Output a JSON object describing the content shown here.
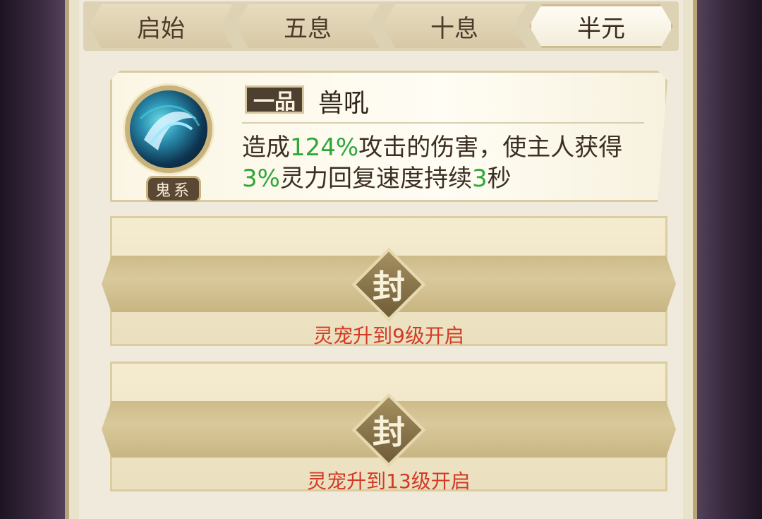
{
  "tabs": [
    {
      "label": "启始",
      "active": false
    },
    {
      "label": "五息",
      "active": false
    },
    {
      "label": "十息",
      "active": false
    },
    {
      "label": "半元",
      "active": true
    }
  ],
  "skill": {
    "grade": "一品",
    "name": "兽吼",
    "type_label": "鬼系",
    "icon": "ghost-beast-icon",
    "desc_parts": [
      "造成",
      "124%",
      "攻击的伤害，使主人获得",
      "3%",
      "灵力回复速度持续",
      "3",
      "秒"
    ]
  },
  "locked_slots": [
    {
      "seal_label": "封",
      "unlock_text": "灵宠升到9级开启"
    },
    {
      "seal_label": "封",
      "unlock_text": "灵宠升到13级开启"
    }
  ],
  "colors": {
    "highlight_green": "#2fa73a",
    "unlock_red": "#d23a26",
    "panel_bg": "#efeadb"
  }
}
